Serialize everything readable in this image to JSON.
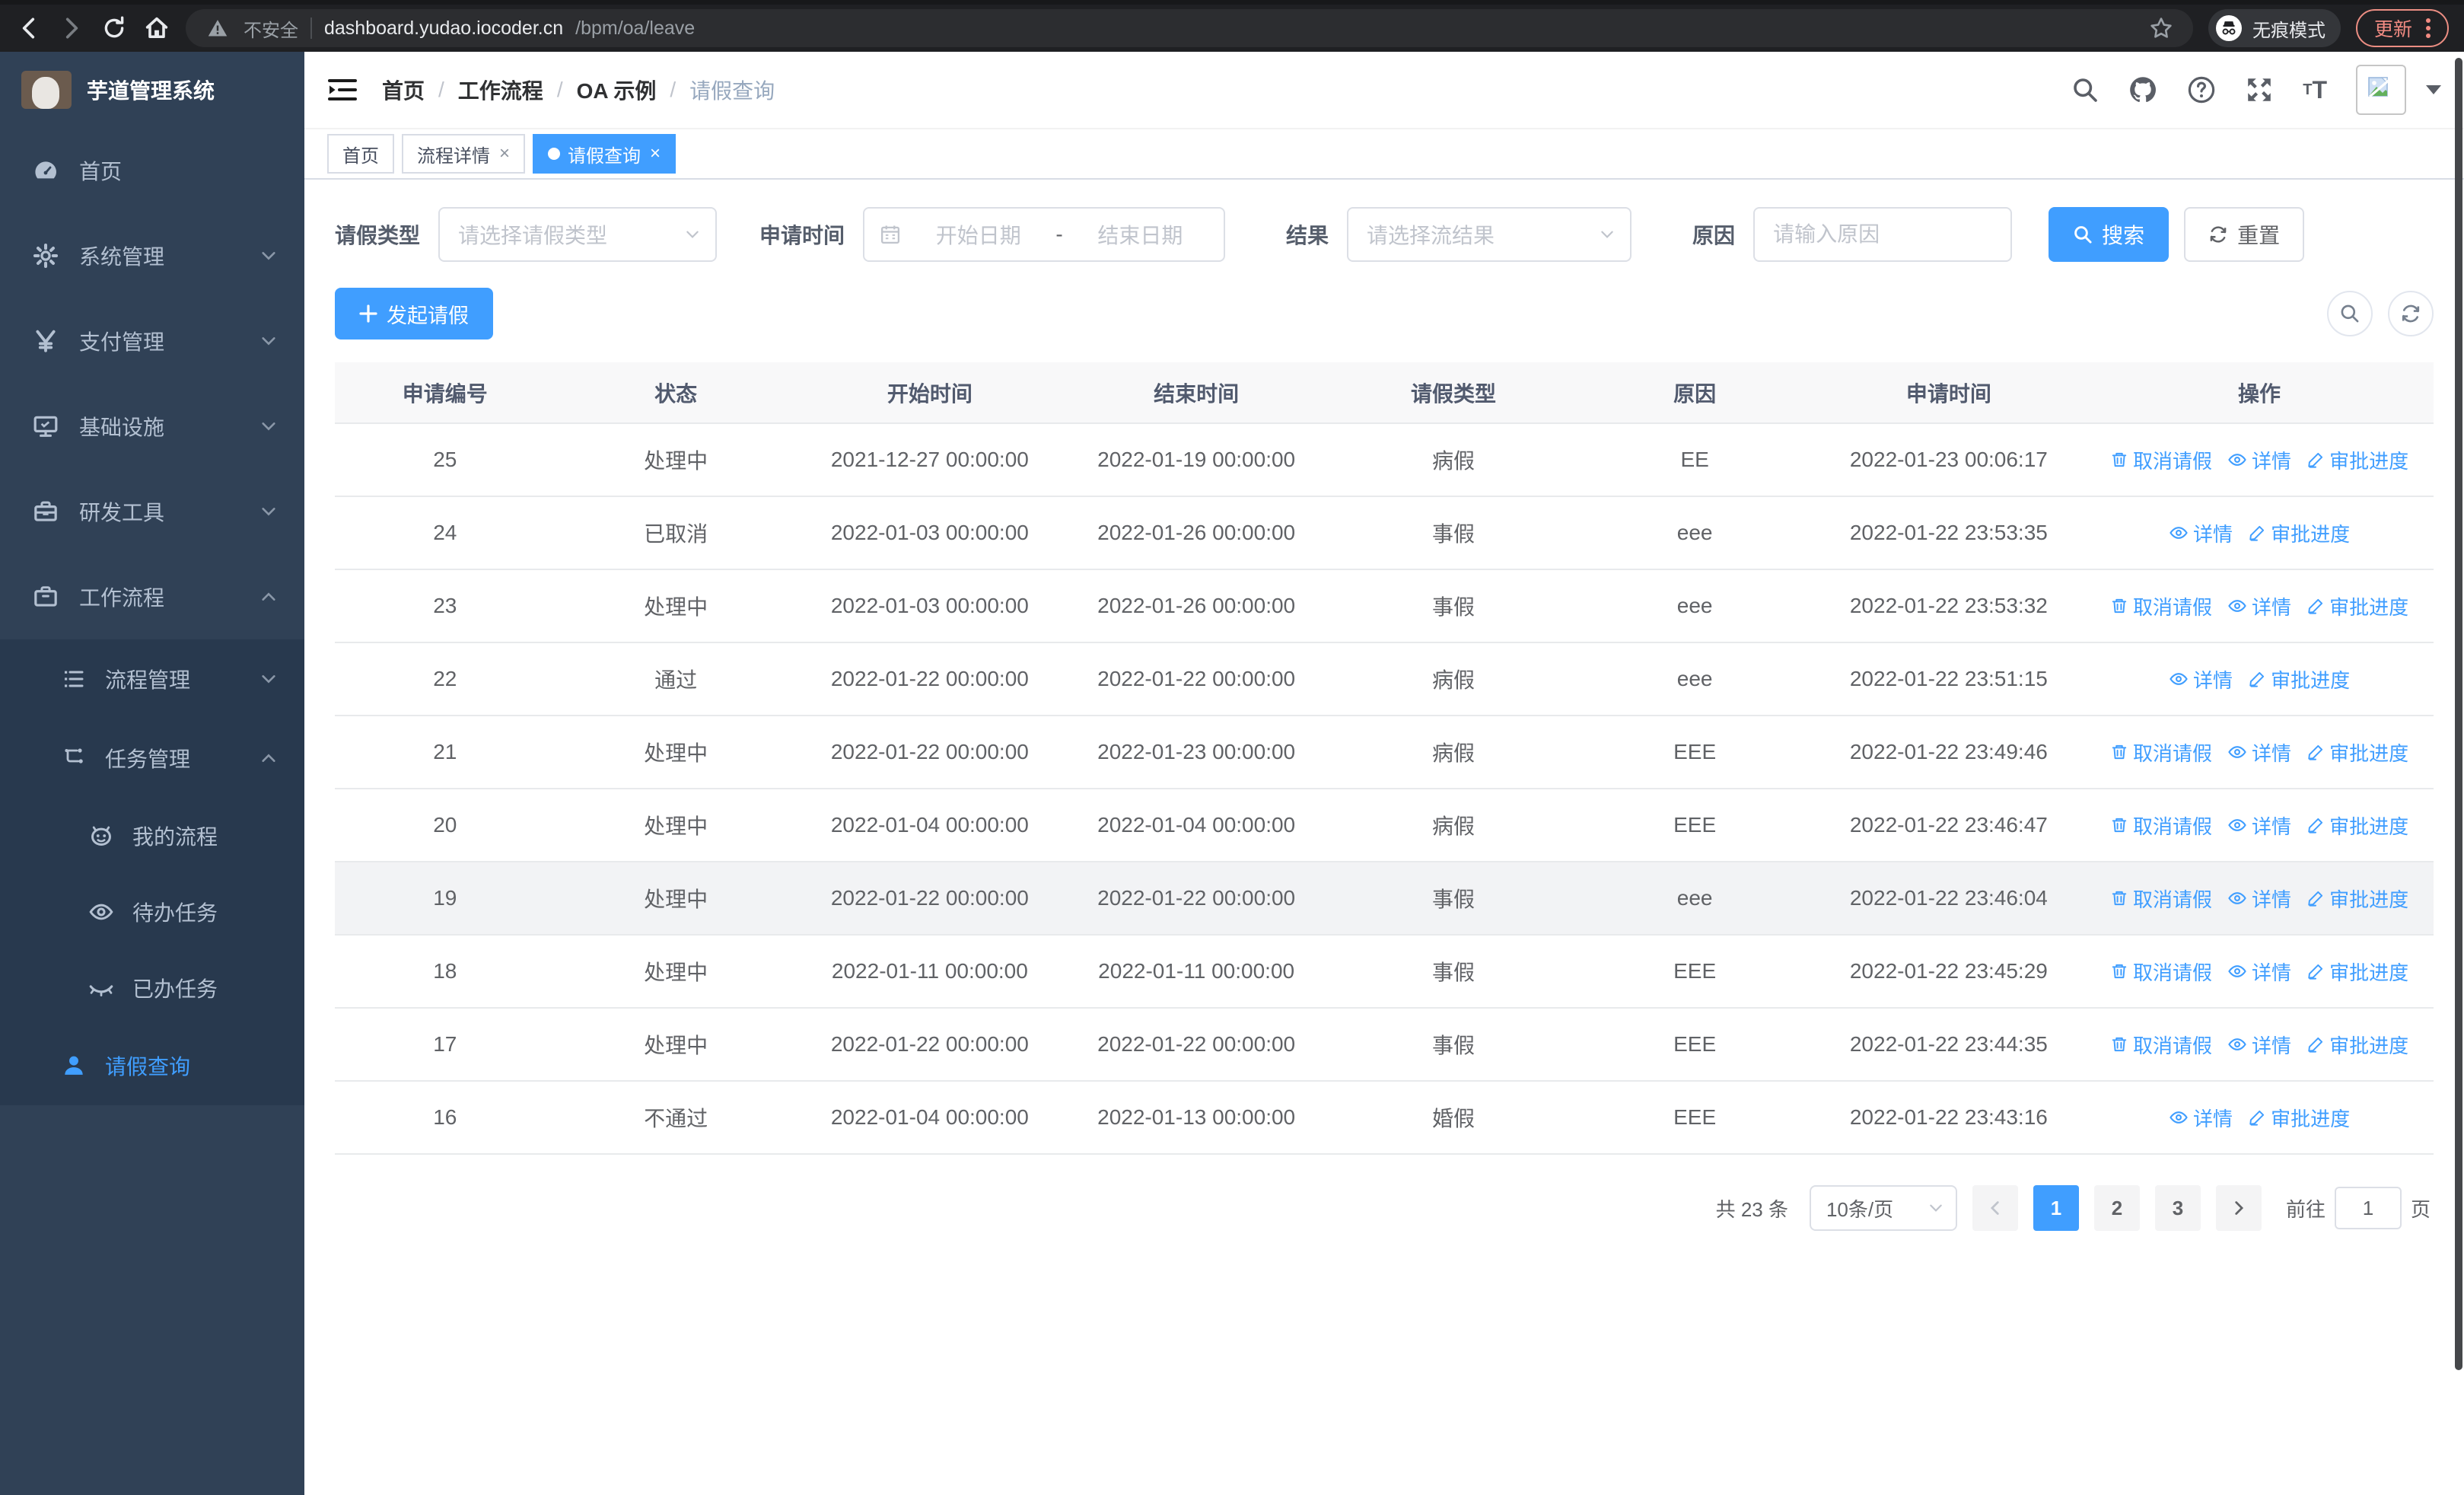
{
  "browser": {
    "security_label": "不安全",
    "url_host": "dashboard.yudao.iocoder.cn",
    "url_path": "/bpm/oa/leave",
    "incognito_label": "无痕模式",
    "update_label": "更新"
  },
  "sidebar": {
    "logo_title": "芋道管理系统",
    "items": [
      {
        "label": "首页",
        "icon": "dashboard-icon"
      },
      {
        "label": "系统管理",
        "icon": "gear-icon"
      },
      {
        "label": "支付管理",
        "icon": "yen-icon"
      },
      {
        "label": "基础设施",
        "icon": "monitor-icon"
      },
      {
        "label": "研发工具",
        "icon": "toolbox-icon"
      },
      {
        "label": "工作流程",
        "icon": "briefcase-icon",
        "expanded": true
      }
    ],
    "workflow_children": [
      {
        "label": "流程管理",
        "icon": "list-icon"
      },
      {
        "label": "任务管理",
        "icon": "share-icon",
        "expanded": true
      },
      {
        "label": "请假查询",
        "icon": "user-icon",
        "active": true
      }
    ],
    "task_children": [
      {
        "label": "我的流程",
        "icon": "robot-icon"
      },
      {
        "label": "待办任务",
        "icon": "eye-icon"
      },
      {
        "label": "已办任务",
        "icon": "eye-closed-icon"
      }
    ]
  },
  "navbar": {
    "breadcrumb": [
      "首页",
      "工作流程",
      "OA 示例",
      "请假查询"
    ]
  },
  "tabs": {
    "items": [
      {
        "label": "首页",
        "closable": false,
        "active": false
      },
      {
        "label": "流程详情",
        "closable": true,
        "active": false
      },
      {
        "label": "请假查询",
        "closable": true,
        "active": true
      }
    ]
  },
  "filters": {
    "leave_type_label": "请假类型",
    "leave_type_placeholder": "请选择请假类型",
    "apply_time_label": "申请时间",
    "start_date_placeholder": "开始日期",
    "date_separator": "-",
    "end_date_placeholder": "结束日期",
    "result_label": "结果",
    "result_placeholder": "请选择流结果",
    "reason_label": "原因",
    "reason_placeholder": "请输入原因",
    "search_label": "搜索",
    "reset_label": "重置"
  },
  "toolbar": {
    "create_label": "发起请假"
  },
  "table": {
    "headers": [
      "申请编号",
      "状态",
      "开始时间",
      "结束时间",
      "请假类型",
      "原因",
      "申请时间",
      "操作"
    ],
    "actions": {
      "cancel": "取消请假",
      "detail": "详情",
      "progress": "审批进度"
    },
    "rows": [
      {
        "id": "25",
        "status": "处理中",
        "start": "2021-12-27 00:00:00",
        "end": "2022-01-19 00:00:00",
        "type": "病假",
        "reason": "EE",
        "applied": "2022-01-23 00:06:17",
        "cancelable": true
      },
      {
        "id": "24",
        "status": "已取消",
        "start": "2022-01-03 00:00:00",
        "end": "2022-01-26 00:00:00",
        "type": "事假",
        "reason": "eee",
        "applied": "2022-01-22 23:53:35",
        "cancelable": false
      },
      {
        "id": "23",
        "status": "处理中",
        "start": "2022-01-03 00:00:00",
        "end": "2022-01-26 00:00:00",
        "type": "事假",
        "reason": "eee",
        "applied": "2022-01-22 23:53:32",
        "cancelable": true
      },
      {
        "id": "22",
        "status": "通过",
        "start": "2022-01-22 00:00:00",
        "end": "2022-01-22 00:00:00",
        "type": "病假",
        "reason": "eee",
        "applied": "2022-01-22 23:51:15",
        "cancelable": false
      },
      {
        "id": "21",
        "status": "处理中",
        "start": "2022-01-22 00:00:00",
        "end": "2022-01-23 00:00:00",
        "type": "病假",
        "reason": "EEE",
        "applied": "2022-01-22 23:49:46",
        "cancelable": true
      },
      {
        "id": "20",
        "status": "处理中",
        "start": "2022-01-04 00:00:00",
        "end": "2022-01-04 00:00:00",
        "type": "病假",
        "reason": "EEE",
        "applied": "2022-01-22 23:46:47",
        "cancelable": true
      },
      {
        "id": "19",
        "status": "处理中",
        "start": "2022-01-22 00:00:00",
        "end": "2022-01-22 00:00:00",
        "type": "事假",
        "reason": "eee",
        "applied": "2022-01-22 23:46:04",
        "cancelable": true,
        "hover": true
      },
      {
        "id": "18",
        "status": "处理中",
        "start": "2022-01-11 00:00:00",
        "end": "2022-01-11 00:00:00",
        "type": "事假",
        "reason": "EEE",
        "applied": "2022-01-22 23:45:29",
        "cancelable": true
      },
      {
        "id": "17",
        "status": "处理中",
        "start": "2022-01-22 00:00:00",
        "end": "2022-01-22 00:00:00",
        "type": "事假",
        "reason": "EEE",
        "applied": "2022-01-22 23:44:35",
        "cancelable": true
      },
      {
        "id": "16",
        "status": "不通过",
        "start": "2022-01-04 00:00:00",
        "end": "2022-01-13 00:00:00",
        "type": "婚假",
        "reason": "EEE",
        "applied": "2022-01-22 23:43:16",
        "cancelable": false
      }
    ]
  },
  "pagination": {
    "total_label": "共 23 条",
    "page_size_label": "10条/页",
    "pages": [
      "1",
      "2",
      "3"
    ],
    "active_page": "1",
    "goto_label": "前往",
    "goto_value": "1",
    "page_unit_label": "页"
  },
  "colors": {
    "accent_blue": "#409eff",
    "sidebar_bg": "#304156",
    "sidebar_submenu_bg": "#28394e",
    "browser_bar_bg": "#1f2023",
    "update_button_red": "#f28b82",
    "table_header_bg": "#f8f8f9",
    "hover_row_bg": "#f2f3f5"
  }
}
